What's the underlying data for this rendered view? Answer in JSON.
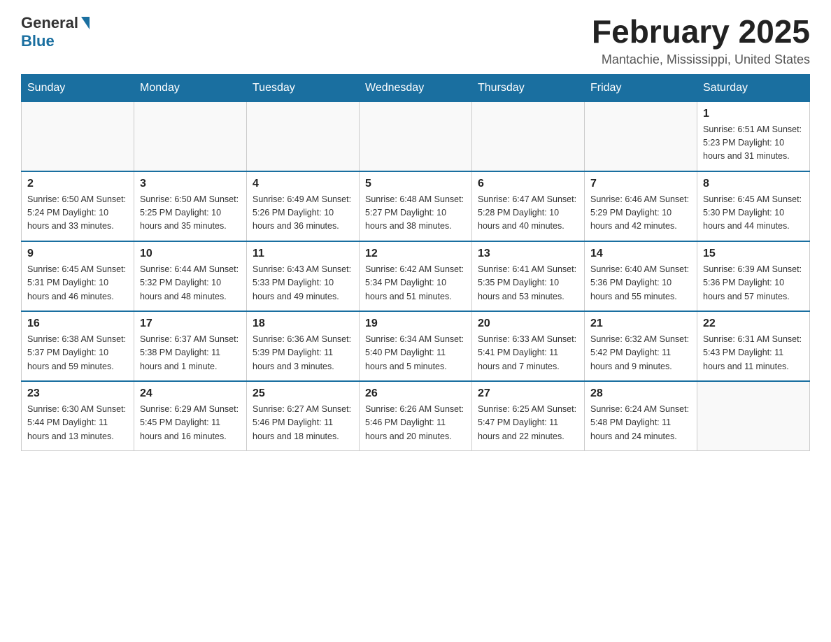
{
  "header": {
    "logo_general": "General",
    "logo_blue": "Blue",
    "month_year": "February 2025",
    "location": "Mantachie, Mississippi, United States"
  },
  "days_of_week": [
    "Sunday",
    "Monday",
    "Tuesday",
    "Wednesday",
    "Thursday",
    "Friday",
    "Saturday"
  ],
  "weeks": [
    [
      {
        "day": "",
        "info": ""
      },
      {
        "day": "",
        "info": ""
      },
      {
        "day": "",
        "info": ""
      },
      {
        "day": "",
        "info": ""
      },
      {
        "day": "",
        "info": ""
      },
      {
        "day": "",
        "info": ""
      },
      {
        "day": "1",
        "info": "Sunrise: 6:51 AM\nSunset: 5:23 PM\nDaylight: 10 hours\nand 31 minutes."
      }
    ],
    [
      {
        "day": "2",
        "info": "Sunrise: 6:50 AM\nSunset: 5:24 PM\nDaylight: 10 hours\nand 33 minutes."
      },
      {
        "day": "3",
        "info": "Sunrise: 6:50 AM\nSunset: 5:25 PM\nDaylight: 10 hours\nand 35 minutes."
      },
      {
        "day": "4",
        "info": "Sunrise: 6:49 AM\nSunset: 5:26 PM\nDaylight: 10 hours\nand 36 minutes."
      },
      {
        "day": "5",
        "info": "Sunrise: 6:48 AM\nSunset: 5:27 PM\nDaylight: 10 hours\nand 38 minutes."
      },
      {
        "day": "6",
        "info": "Sunrise: 6:47 AM\nSunset: 5:28 PM\nDaylight: 10 hours\nand 40 minutes."
      },
      {
        "day": "7",
        "info": "Sunrise: 6:46 AM\nSunset: 5:29 PM\nDaylight: 10 hours\nand 42 minutes."
      },
      {
        "day": "8",
        "info": "Sunrise: 6:45 AM\nSunset: 5:30 PM\nDaylight: 10 hours\nand 44 minutes."
      }
    ],
    [
      {
        "day": "9",
        "info": "Sunrise: 6:45 AM\nSunset: 5:31 PM\nDaylight: 10 hours\nand 46 minutes."
      },
      {
        "day": "10",
        "info": "Sunrise: 6:44 AM\nSunset: 5:32 PM\nDaylight: 10 hours\nand 48 minutes."
      },
      {
        "day": "11",
        "info": "Sunrise: 6:43 AM\nSunset: 5:33 PM\nDaylight: 10 hours\nand 49 minutes."
      },
      {
        "day": "12",
        "info": "Sunrise: 6:42 AM\nSunset: 5:34 PM\nDaylight: 10 hours\nand 51 minutes."
      },
      {
        "day": "13",
        "info": "Sunrise: 6:41 AM\nSunset: 5:35 PM\nDaylight: 10 hours\nand 53 minutes."
      },
      {
        "day": "14",
        "info": "Sunrise: 6:40 AM\nSunset: 5:36 PM\nDaylight: 10 hours\nand 55 minutes."
      },
      {
        "day": "15",
        "info": "Sunrise: 6:39 AM\nSunset: 5:36 PM\nDaylight: 10 hours\nand 57 minutes."
      }
    ],
    [
      {
        "day": "16",
        "info": "Sunrise: 6:38 AM\nSunset: 5:37 PM\nDaylight: 10 hours\nand 59 minutes."
      },
      {
        "day": "17",
        "info": "Sunrise: 6:37 AM\nSunset: 5:38 PM\nDaylight: 11 hours\nand 1 minute."
      },
      {
        "day": "18",
        "info": "Sunrise: 6:36 AM\nSunset: 5:39 PM\nDaylight: 11 hours\nand 3 minutes."
      },
      {
        "day": "19",
        "info": "Sunrise: 6:34 AM\nSunset: 5:40 PM\nDaylight: 11 hours\nand 5 minutes."
      },
      {
        "day": "20",
        "info": "Sunrise: 6:33 AM\nSunset: 5:41 PM\nDaylight: 11 hours\nand 7 minutes."
      },
      {
        "day": "21",
        "info": "Sunrise: 6:32 AM\nSunset: 5:42 PM\nDaylight: 11 hours\nand 9 minutes."
      },
      {
        "day": "22",
        "info": "Sunrise: 6:31 AM\nSunset: 5:43 PM\nDaylight: 11 hours\nand 11 minutes."
      }
    ],
    [
      {
        "day": "23",
        "info": "Sunrise: 6:30 AM\nSunset: 5:44 PM\nDaylight: 11 hours\nand 13 minutes."
      },
      {
        "day": "24",
        "info": "Sunrise: 6:29 AM\nSunset: 5:45 PM\nDaylight: 11 hours\nand 16 minutes."
      },
      {
        "day": "25",
        "info": "Sunrise: 6:27 AM\nSunset: 5:46 PM\nDaylight: 11 hours\nand 18 minutes."
      },
      {
        "day": "26",
        "info": "Sunrise: 6:26 AM\nSunset: 5:46 PM\nDaylight: 11 hours\nand 20 minutes."
      },
      {
        "day": "27",
        "info": "Sunrise: 6:25 AM\nSunset: 5:47 PM\nDaylight: 11 hours\nand 22 minutes."
      },
      {
        "day": "28",
        "info": "Sunrise: 6:24 AM\nSunset: 5:48 PM\nDaylight: 11 hours\nand 24 minutes."
      },
      {
        "day": "",
        "info": ""
      }
    ]
  ]
}
